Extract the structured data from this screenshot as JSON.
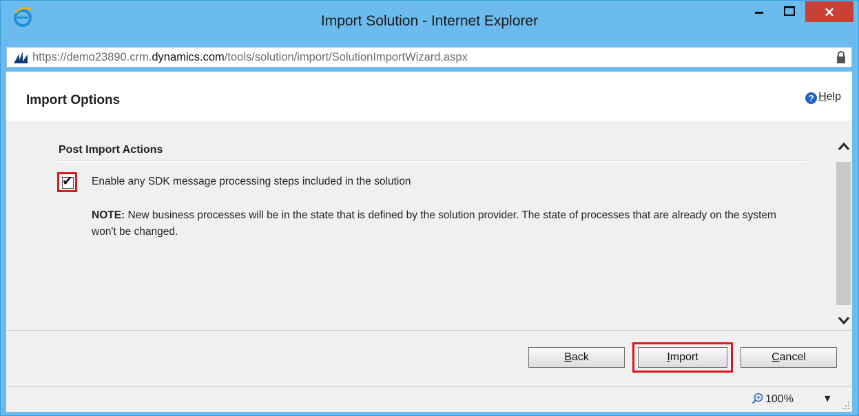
{
  "window": {
    "title": "Import Solution - Internet Explorer",
    "minimize_label": "",
    "close_label": "×",
    "accent_color": "#6bbbee",
    "close_color": "#c94135"
  },
  "address": {
    "url_prefix": "https://demo23890.crm.",
    "url_domain": "dynamics.com",
    "url_path": "/tools/solution/import/SolutionImportWizard.aspx"
  },
  "header": {
    "title": "Import Options",
    "help_label": "Help",
    "help_accesskey": "H"
  },
  "section": {
    "title": "Post Import Actions",
    "checkbox": {
      "checked": true,
      "label": "Enable any SDK message processing steps included in the solution"
    },
    "note_bold": "NOTE:",
    "note_text": " New business processes will be in the state that is defined by the solution provider. The state of processes that are already on the system won't be changed."
  },
  "footer": {
    "back_label": "Back",
    "import_label": "Import",
    "cancel_label": "Cancel",
    "highlight_color": "#e3141c"
  },
  "status": {
    "zoom": "100%"
  },
  "icons": {
    "browser": "ie-icon",
    "site": "dynamics-icon",
    "lock": "lock-icon",
    "help": "help-icon",
    "zoom": "zoom-icon"
  }
}
